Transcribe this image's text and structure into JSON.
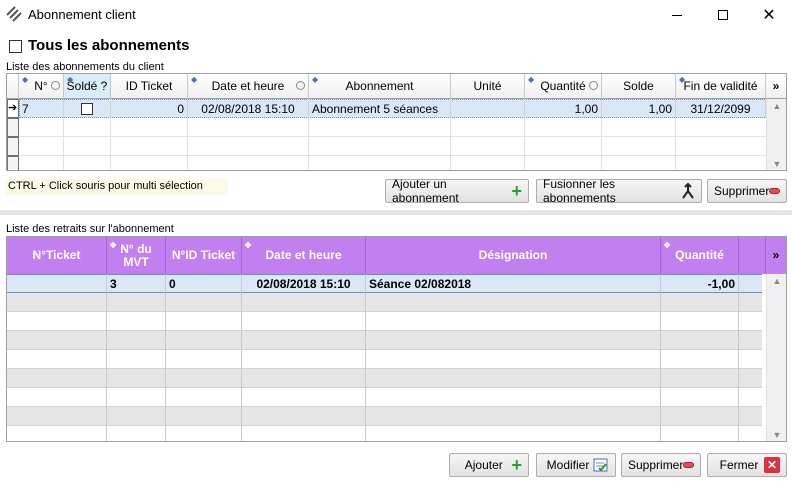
{
  "window": {
    "title": "Abonnement client",
    "minimize": "—",
    "maximize": "☐",
    "close": "✕"
  },
  "all_subscriptions": {
    "label": "Tous les abonnements",
    "checked": false
  },
  "list1": {
    "label": "Liste des abonnements du client",
    "columns": [
      "N°",
      "Soldé ?",
      "ID Ticket",
      "Date et heure",
      "Abonnement",
      "Unité",
      "Quantité",
      "Solde",
      "Fin de validité"
    ],
    "more": "»",
    "rows": [
      {
        "n": "7",
        "solde_check": false,
        "id_ticket": "0",
        "date": "02/08/2018 15:10",
        "abonnement": "Abonnement 5 séances",
        "unite": "",
        "quantite": "1,00",
        "solde": "1,00",
        "fin": "31/12/2099"
      }
    ]
  },
  "hint": "CTRL + Click souris pour multi sélection",
  "buttons1": {
    "add": "Ajouter un abonnement",
    "merge": "Fusionner les abonnements",
    "delete": "Supprimer"
  },
  "list2": {
    "label": "Liste des retraits sur l'abonnement",
    "columns": [
      "N°Ticket",
      "N° du MVT",
      "N°ID Ticket",
      "Date et heure",
      "Désignation",
      "Quantité"
    ],
    "more": "»",
    "rows": [
      {
        "ticket": "",
        "mvt": "3",
        "id_ticket": "0",
        "date": "02/08/2018 15:10",
        "designation": "Séance 02/082018",
        "quantite": "-1,00"
      }
    ]
  },
  "buttons2": {
    "add": "Ajouter",
    "modify": "Modifier",
    "delete": "Supprimer",
    "close": "Fermer"
  },
  "colors": {
    "header_purple": "#c27ff0",
    "selected_row": "#d9e7f7",
    "alt_row": "#e6e6e6"
  }
}
